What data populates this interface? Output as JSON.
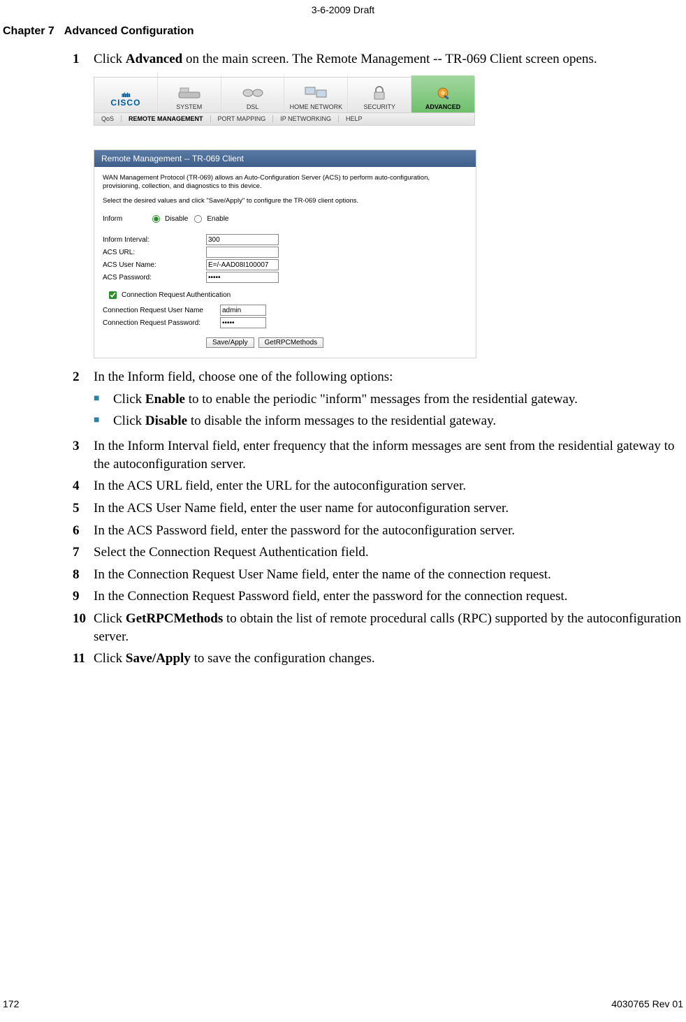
{
  "header": {
    "draft": "3-6-2009 Draft"
  },
  "chapter": {
    "num": "Chapter 7",
    "title": "Advanced Configuration"
  },
  "steps": {
    "s1": {
      "num": "1",
      "a": "Click ",
      "b": "Advanced",
      "c": " on the main screen. The Remote Management -- TR-069 Client screen opens."
    },
    "s2": {
      "num": "2",
      "text": "In the Inform field, choose one of the following options:"
    },
    "s3": {
      "num": "3",
      "text": "In the Inform Interval field, enter frequency that the inform messages are sent from the residential gateway to the autoconfiguration server."
    },
    "s4": {
      "num": "4",
      "text": "In the ACS URL field, enter the URL for the autoconfiguration server."
    },
    "s5": {
      "num": "5",
      "text": "In the ACS User Name field, enter the user name for autoconfiguration server."
    },
    "s6": {
      "num": "6",
      "text": "In the ACS Password field, enter the password for the autoconfiguration server."
    },
    "s7": {
      "num": "7",
      "text": "Select the Connection Request Authentication field."
    },
    "s8": {
      "num": "8",
      "text": "In the Connection Request User Name field, enter the name of the connection request."
    },
    "s9": {
      "num": "9",
      "text": "In the Connection Request Password field, enter the password for the connection request."
    },
    "s10": {
      "num": "10",
      "a": "Click ",
      "b": "GetRPCMethods",
      "c": " to obtain the list of remote procedural calls (RPC) supported by the autoconfiguration server."
    },
    "s11": {
      "num": "11",
      "a": "Click ",
      "b": "Save/Apply",
      "c": " to save the configuration changes."
    }
  },
  "bullets": {
    "b1": {
      "a": "Click ",
      "b": "Enable",
      "c": " to to enable the periodic \"inform\" messages from the residential gateway."
    },
    "b2": {
      "a": "Click ",
      "b": "Disable",
      "c": " to disable the inform messages to the residential gateway."
    }
  },
  "ui": {
    "brand_bars": "ıılıılıı",
    "brand": "CISCO",
    "nav": {
      "system": "SYSTEM",
      "dsl": "DSL",
      "home": "HOME NETWORK",
      "security": "SECURITY",
      "advanced": "ADVANCED"
    },
    "subnav": {
      "qos": "QoS",
      "remote": "REMOTE MANAGEMENT",
      "port": "PORT MAPPING",
      "ip": "IP NETWORKING",
      "help": "HELP"
    },
    "panel": {
      "title": "Remote Management -- TR-069 Client",
      "desc1": "WAN Management Protocol (TR-069) allows an Auto-Configuration Server (ACS) to perform auto-configuration, provisioning, collection, and diagnostics to this device.",
      "desc2": "Select the desired values and click \"Save/Apply\" to configure the TR-069 client options.",
      "inform_label": "Inform",
      "disable": "Disable",
      "enable": "Enable",
      "rows": {
        "interval": {
          "label": "Inform Interval:",
          "value": "300"
        },
        "url": {
          "label": "ACS URL:",
          "value": ""
        },
        "user": {
          "label": "ACS User Name:",
          "value": "E=/-AAD08I100007"
        },
        "pass": {
          "label": "ACS Password:",
          "value": "•••••"
        }
      },
      "cb_label": "Connection Request Authentication",
      "cr_user": {
        "label": "Connection Request User Name",
        "value": "admin"
      },
      "cr_pass": {
        "label": "Connection Request Password:",
        "value": "•••••"
      },
      "btn_save": "Save/Apply",
      "btn_rpc": "GetRPCMethods"
    }
  },
  "footer": {
    "page": "172",
    "rev": "4030765 Rev 01"
  }
}
